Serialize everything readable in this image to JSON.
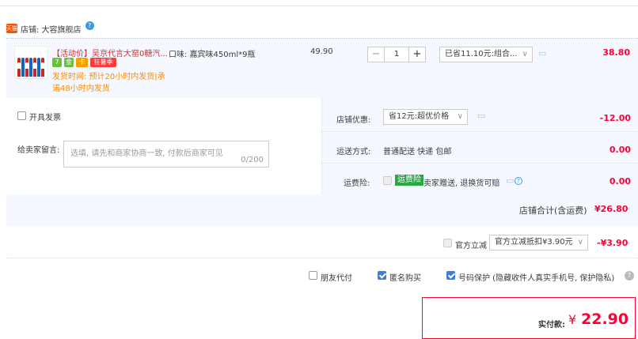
{
  "shop": {
    "tag": "天猫",
    "label": "店铺: 大容旗舰店",
    "help": "?"
  },
  "item": {
    "title": "【活动价】吴京代言大窑0糖汽...",
    "badges": [
      "7",
      "金",
      "卡",
      "狂暑季"
    ],
    "ship_line1": "发货时间: 预计20小时内发货|承",
    "ship_line2": "诺48小时内发货",
    "spec": "口味: 嘉宾味450ml*9瓶",
    "price": "49.90",
    "qty": "1",
    "qty_minus": "−",
    "qty_plus": "+",
    "discount_select": "已省11.10元:组合...",
    "amount": "38.80"
  },
  "invoice": {
    "label": "开具发票"
  },
  "message": {
    "label": "给卖家留言:",
    "placeholder": "选填, 请先和商家协商一致, 付款后商家可见",
    "counter": "0/200"
  },
  "shop_discount": {
    "label": "店铺优惠:",
    "select": "省12元:超优价格",
    "amount": "-12.00"
  },
  "shipping": {
    "label": "运送方式:",
    "value": "普通配送 快递 包邮",
    "amount": "0.00"
  },
  "insurance": {
    "label": "运费险:",
    "tag": "运费险",
    "text": "卖家赠送, 退换货可赔",
    "amount": "0.00"
  },
  "subtotal": {
    "label": "店铺合计(含运费)",
    "amount": "¥26.80"
  },
  "gov": {
    "label": "官方立减",
    "select": "官方立减抵扣¥3.90元",
    "amount": "-¥3.90"
  },
  "options": {
    "friend_pay": "朋友代付",
    "anonymous": "匿名购买",
    "number_protect": "号码保护 (隐藏收件人真实手机号, 保护隐私)"
  },
  "pay": {
    "label": "实付款:",
    "yen": "¥",
    "amount": "22.90"
  },
  "colors": {
    "accent": "#ff0036",
    "blue": "#3a7ce0",
    "light_bg": "#f5f9ff"
  }
}
